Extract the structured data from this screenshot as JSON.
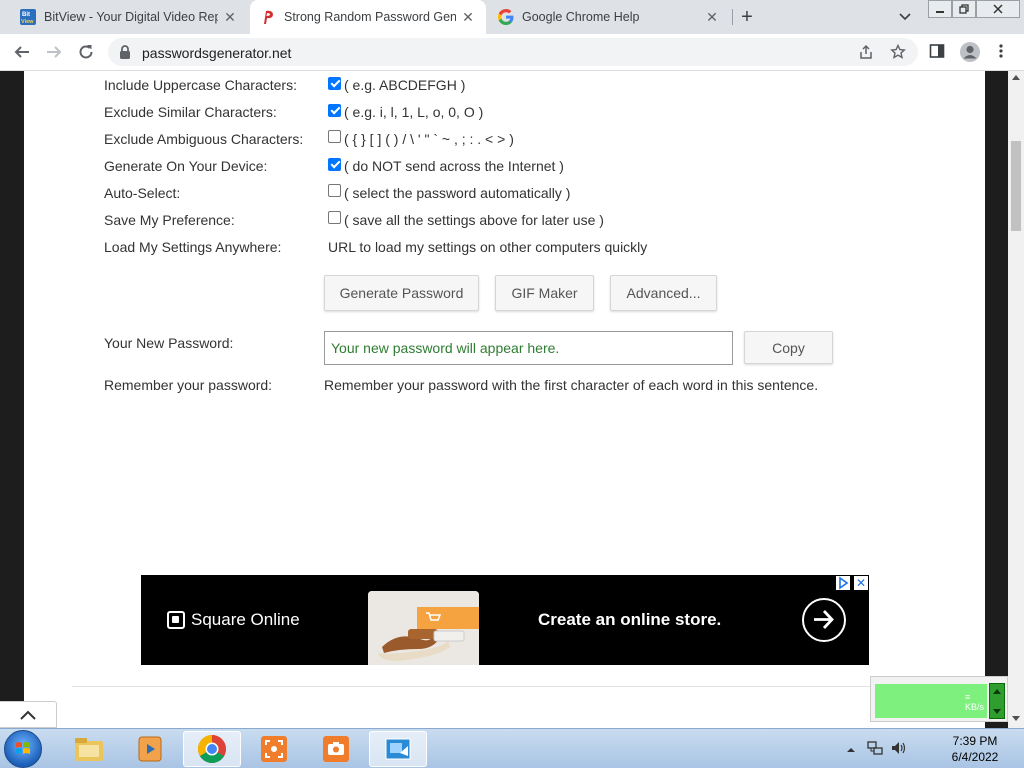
{
  "browser": {
    "tabs": [
      {
        "title": "BitView - Your Digital Video Repository",
        "icon": "bitview-icon",
        "active": false
      },
      {
        "title": "Strong Random Password Generator",
        "icon": "passwords-generator-icon",
        "active": true
      },
      {
        "title": "Google Chrome Help",
        "icon": "google-icon",
        "active": false
      }
    ],
    "url": "passwordsgenerator.net"
  },
  "form": {
    "rows": [
      {
        "label": "Include Uppercase Characters:",
        "checked": true,
        "hint": "( e.g. ABCDEFGH )"
      },
      {
        "label": "Exclude Similar Characters:",
        "checked": true,
        "hint": "( e.g. i, l, 1, L, o, 0, O )"
      },
      {
        "label": "Exclude Ambiguous Characters:",
        "checked": false,
        "hint": "( { } [ ] ( ) / \\ ' \" ` ~ , ; : . < > )"
      },
      {
        "label": "Generate On Your Device:",
        "checked": true,
        "hint": "( do NOT send across the Internet )"
      },
      {
        "label": "Auto-Select:",
        "checked": false,
        "hint": "( select the password automatically )"
      },
      {
        "label": "Save My Preference:",
        "checked": false,
        "hint": "( save all the settings above for later use )"
      }
    ],
    "load_settings_label": "Load My Settings Anywhere:",
    "load_settings_text": "URL to load my settings on other computers quickly",
    "buttons": {
      "generate": "Generate Password",
      "gif": "GIF Maker",
      "advanced": "Advanced..."
    },
    "new_password_label": "Your New Password:",
    "new_password_placeholder": "Your new password will appear here.",
    "copy": "Copy",
    "remember_label": "Remember your password:",
    "remember_text": "Remember your password with the first character of each word in this sentence."
  },
  "ad": {
    "brand": "Square Online",
    "cta": "Create an online store."
  },
  "taskbar": {
    "time": "7:39 PM",
    "date": "6/4/2022"
  },
  "colors": {
    "checkbox": "#0075ff",
    "password_text": "#2e7d32",
    "ad_background": "#000000"
  }
}
